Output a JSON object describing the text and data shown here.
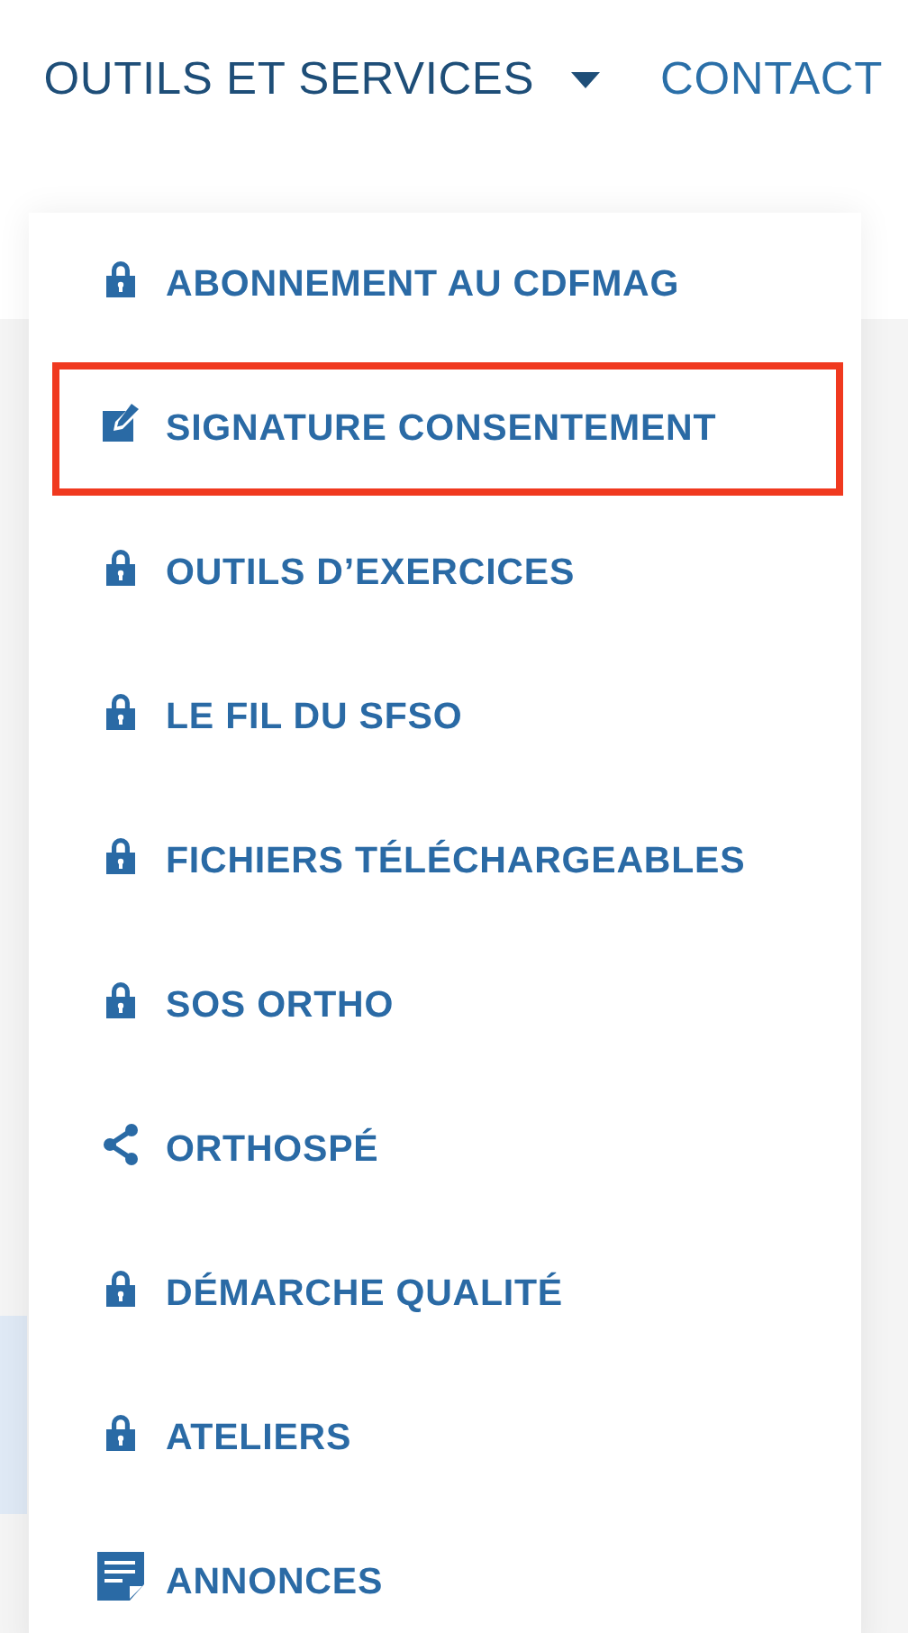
{
  "nav": [
    {
      "label": "OUTILS ET SERVICES",
      "has_caret": true,
      "expanded": true
    },
    {
      "label": "CONTACT",
      "has_caret": false,
      "expanded": false
    }
  ],
  "dropdown": {
    "items": [
      {
        "label": "ABONNEMENT AU CDFMAG",
        "kind": "lock",
        "highlighted": false
      },
      {
        "label": "SIGNATURE CONSENTEMENT",
        "kind": "edit",
        "highlighted": true
      },
      {
        "label": "OUTILS D’EXERCICES",
        "kind": "lock",
        "highlighted": false
      },
      {
        "label": "LE FIL DU SFSO",
        "kind": "lock",
        "highlighted": false
      },
      {
        "label": "FICHIERS TÉLÉCHARGEABLES",
        "kind": "lock",
        "highlighted": false
      },
      {
        "label": "SOS ORTHO",
        "kind": "lock",
        "highlighted": false
      },
      {
        "label": "ORTHOSPÉ",
        "kind": "share",
        "highlighted": false
      },
      {
        "label": "DÉMARCHE QUALITÉ",
        "kind": "lock",
        "highlighted": false
      },
      {
        "label": "ATELIERS",
        "kind": "lock",
        "highlighted": false
      },
      {
        "label": "ANNONCES",
        "kind": "note",
        "highlighted": false
      }
    ]
  }
}
